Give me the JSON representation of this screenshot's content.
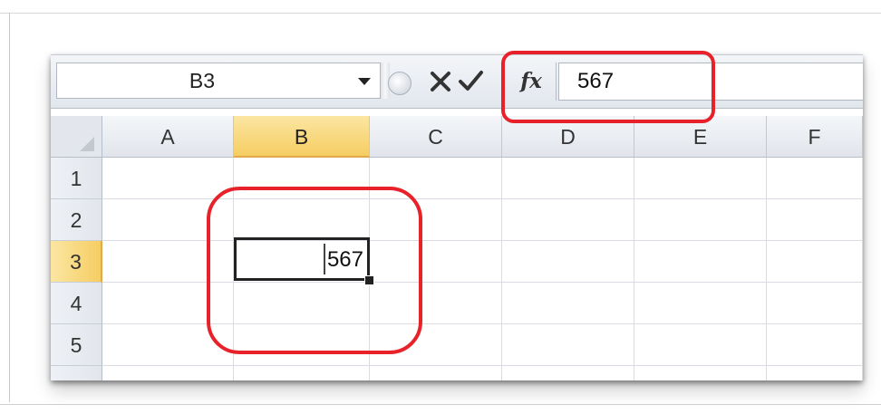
{
  "name_box": {
    "value": "B3"
  },
  "formula_bar": {
    "fx_label": "fx",
    "value": "567"
  },
  "columns": [
    "A",
    "B",
    "C",
    "D",
    "E",
    "F"
  ],
  "selected_column": "B",
  "rows": [
    "1",
    "2",
    "3",
    "4",
    "5"
  ],
  "selected_row": "3",
  "active_cell": {
    "address": "B3",
    "value": "567"
  },
  "colors": {
    "highlight": "#e8222a",
    "selected_header": "#f6cd62",
    "header_bg": "#e1e5eb"
  },
  "icons": [
    "cancel-icon",
    "enter-icon",
    "fx-icon",
    "dropdown-arrow-icon"
  ]
}
